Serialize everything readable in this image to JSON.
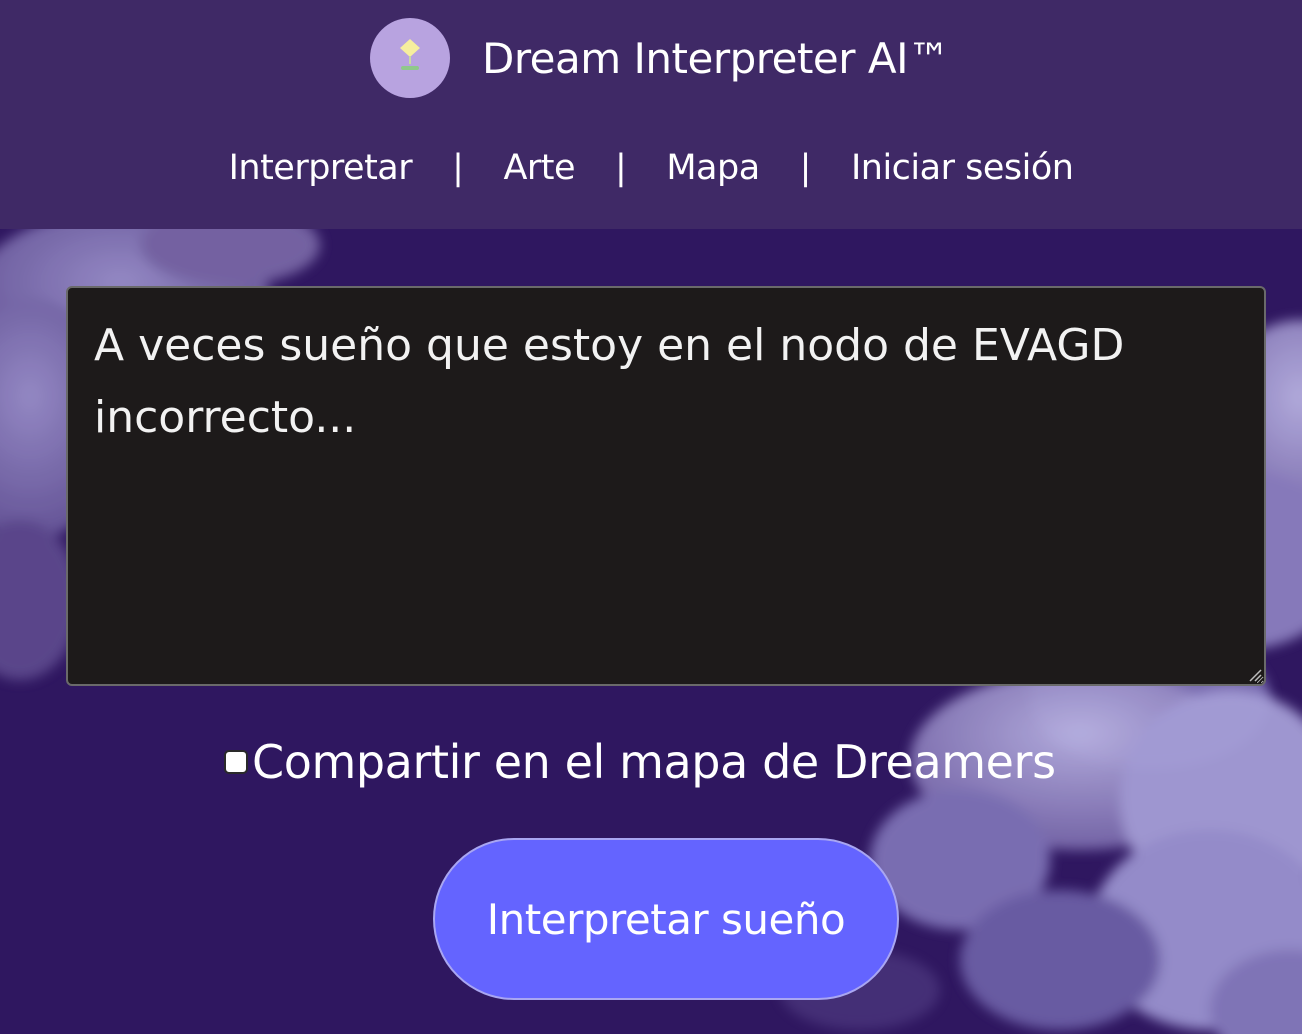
{
  "header": {
    "logo_icon": "sprout-icon",
    "title": "Dream Interpreter AI™"
  },
  "nav": {
    "items": [
      {
        "label": "Interpretar"
      },
      {
        "label": "Arte"
      },
      {
        "label": "Mapa"
      },
      {
        "label": "Iniciar sesión"
      }
    ],
    "separator": "|"
  },
  "dream_input": {
    "placeholder": "A veces sueño que estoy en el nodo de EVAGD incorrecto...",
    "value": ""
  },
  "share": {
    "label": "Compartir en el mapa de Dreamers",
    "checked": false
  },
  "submit": {
    "label": "Interpretar sueño"
  },
  "colors": {
    "header_bg": "#3f2966",
    "page_bg": "#2f1760",
    "logo_bg": "#b8a3e0",
    "input_bg": "#1d1a1a",
    "button_bg": "#6464ff",
    "button_border": "#a9a6f2"
  }
}
